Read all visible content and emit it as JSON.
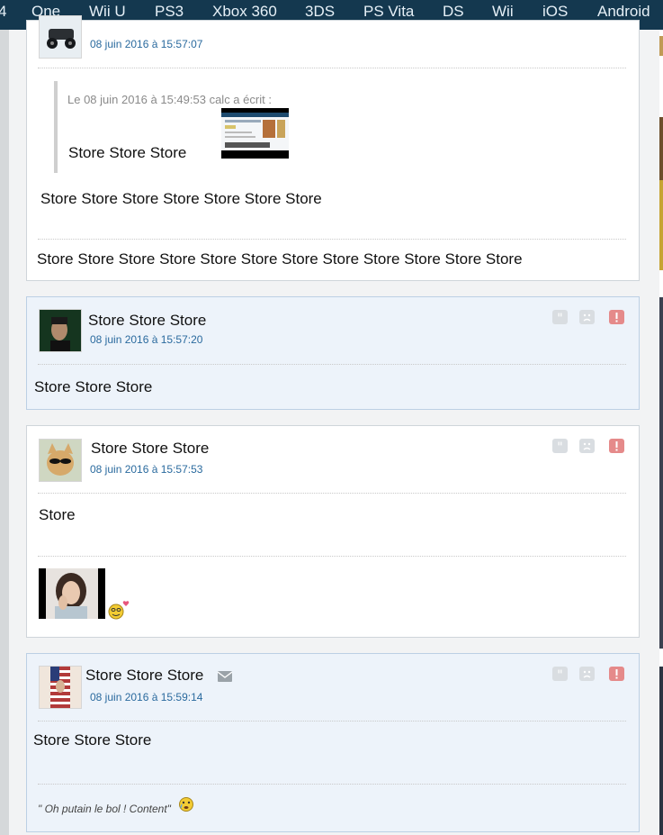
{
  "nav": {
    "items": [
      "One",
      "Wii U",
      "PS3",
      "Xbox 360",
      "3DS",
      "PS Vita",
      "DS",
      "Wii",
      "iOS",
      "Android"
    ]
  },
  "post1": {
    "date": "08 juin 2016 à 15:57:07",
    "quote_header": "Le 08 juin 2016 à 15:49:53 calc a écrit :",
    "quote_text": "Store Store Store",
    "line1": "Store Store Store Store Store Store Store",
    "signature": "Store Store Store Store Store Store Store Store Store Store Store Store"
  },
  "post2": {
    "username": "Store Store Store",
    "date": "08 juin 2016 à 15:57:20",
    "text": "Store Store Store"
  },
  "post3": {
    "username": "Store Store Store",
    "date": "08 juin 2016 à 15:57:53",
    "text": "Store"
  },
  "post4": {
    "username": "Store Store Store",
    "date": "08 juin 2016 à 15:59:14",
    "text": "Store Store Store",
    "signature": "\" Oh putain le bol ! Content\""
  },
  "icons": {
    "quote": "quote-icon",
    "sad": "sad-face-icon",
    "report": "report-icon",
    "mail": "envelope-icon"
  },
  "colors": {
    "nav_bg": "#14384f",
    "nav_text": "#e6f0f7",
    "date": "#2a6a9e",
    "alt_post_bg": "#edf3fa",
    "report": "#e58a8a"
  }
}
